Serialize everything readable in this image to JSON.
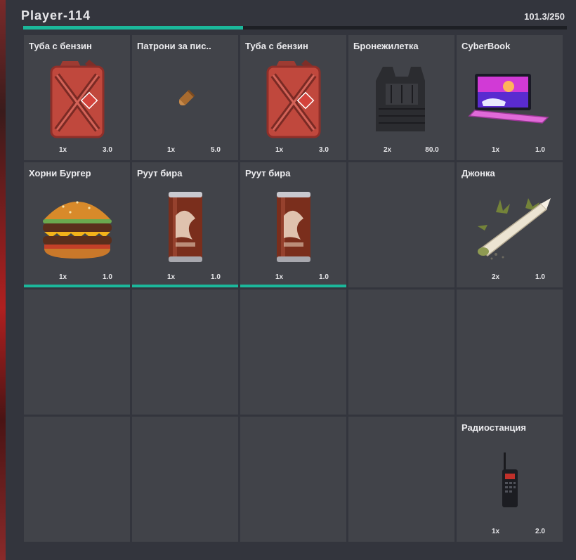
{
  "header": {
    "player_name": "Player-114",
    "weight": "101.3/250",
    "weight_fraction": 0.405
  },
  "colors": {
    "accent": "#1bb89b",
    "slot_bg": "#414349",
    "panel_bg": "#33353d"
  },
  "slots": [
    {
      "name": "Туба с бензин",
      "icon": "jerrycan-icon",
      "qty": "1x",
      "weight": "3.0",
      "bar": false
    },
    {
      "name": "Патрони за пис..",
      "icon": "bullet-icon",
      "qty": "1x",
      "weight": "5.0",
      "bar": false
    },
    {
      "name": "Туба с бензин",
      "icon": "jerrycan-icon",
      "qty": "1x",
      "weight": "3.0",
      "bar": false
    },
    {
      "name": "Бронежилетка",
      "icon": "vest-icon",
      "qty": "2x",
      "weight": "80.0",
      "bar": false
    },
    {
      "name": "CyberBook",
      "icon": "laptop-icon",
      "qty": "1x",
      "weight": "1.0",
      "bar": false
    },
    {
      "name": "Хорни Бургер",
      "icon": "burger-icon",
      "qty": "1x",
      "weight": "1.0",
      "bar": true
    },
    {
      "name": "Руут бира",
      "icon": "can-icon",
      "qty": "1x",
      "weight": "1.0",
      "bar": true
    },
    {
      "name": "Руут бира",
      "icon": "can-icon",
      "qty": "1x",
      "weight": "1.0",
      "bar": true
    },
    null,
    {
      "name": "Джонка",
      "icon": "joint-icon",
      "qty": "2x",
      "weight": "1.0",
      "bar": false
    },
    null,
    null,
    null,
    null,
    null,
    null,
    null,
    null,
    null,
    {
      "name": "Радиостанция",
      "icon": "radio-icon",
      "qty": "1x",
      "weight": "2.0",
      "bar": false
    }
  ]
}
